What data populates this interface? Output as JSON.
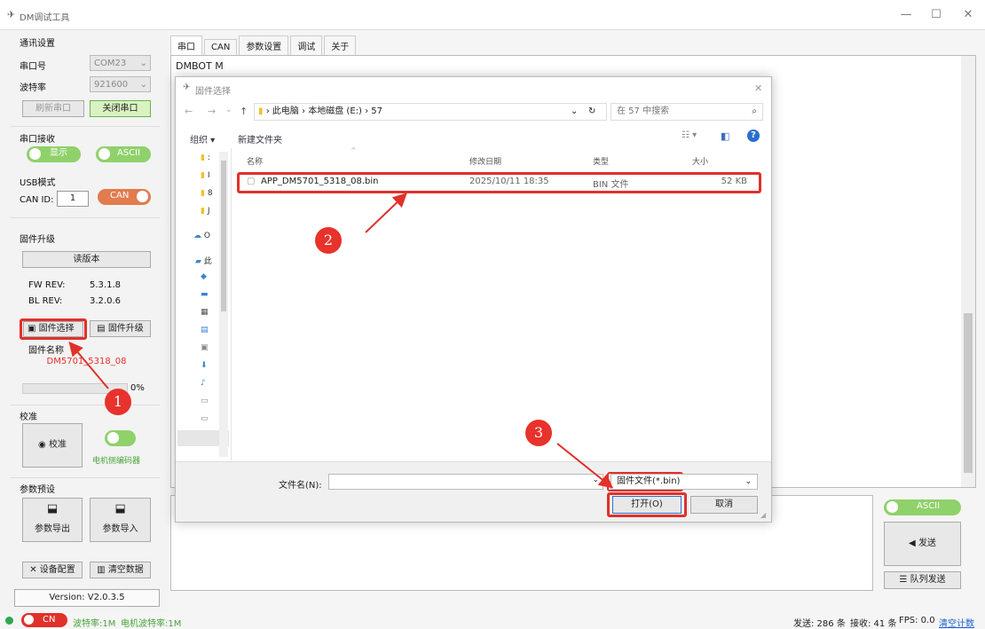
{
  "window": {
    "title": "DM调试工具",
    "minimize": "—",
    "maximize": "☐",
    "close": "✕"
  },
  "left": {
    "comm_settings": "通讯设置",
    "port_label": "串口号",
    "port_value": "COM23",
    "baud_label": "波特率",
    "baud_value": "921600",
    "refresh_btn": "刷新串口",
    "close_port_btn": "关闭串口",
    "rx_label": "串口接收",
    "display_toggle": "显示",
    "ascii_toggle": "ASCII",
    "usb_label": "USB模式",
    "canid_label": "CAN ID:",
    "canid_value": "1",
    "can_toggle": "CAN",
    "fw_upgrade": "固件升级",
    "read_version_btn": "读版本",
    "fw_rev_label": "FW REV:",
    "fw_rev": "5.3.1.8",
    "bl_rev_label": "BL REV:",
    "bl_rev": "3.2.0.6",
    "select_fw_btn": "固件选择",
    "upgrade_btn": "固件升级",
    "fw_name_label": "固件名称",
    "fw_name": "DM5701_5318_08",
    "progress_label": "0%",
    "progress": 0,
    "calib_label": "校准",
    "calib_radio": "校准",
    "encoder_label": "电机侧编码器",
    "params_label": "参数预设",
    "export_btn": "参数导出",
    "import_btn": "参数导入",
    "device_cfg_btn": "设备配置",
    "clear_data_btn": "清空数据",
    "version": "Version: V2.0.3.5"
  },
  "tabs": [
    "串口",
    "CAN",
    "参数设置",
    "调试",
    "关于"
  ],
  "main": {
    "log_line1": "DMBOT M"
  },
  "dialog": {
    "title": "固件选择",
    "path": [
      "此电脑",
      "本地磁盘 (E:)",
      "57"
    ],
    "search_placeholder": "在 57 中搜索",
    "organize": "组织 ▾",
    "new_folder": "新建文件夹",
    "columns": [
      "名称",
      "修改日期",
      "类型",
      "大小"
    ],
    "file": {
      "name": "APP_DM5701_5318_08.bin",
      "date": "2025/10/11 18:35",
      "type": "BIN 文件",
      "size": "52 KB"
    },
    "filename_label": "文件名(N):",
    "filter": "固件文件(*.bin)",
    "open_btn": "打开(O)",
    "cancel_btn": "取消"
  },
  "right": {
    "ascii_toggle": "ASCII",
    "send_btn": "发送",
    "queue_btn": "队列发送"
  },
  "annotations": [
    "1",
    "2",
    "3"
  ],
  "status": {
    "can_toggle": "CN",
    "baud": "波特率:1M",
    "motor_baud": "电机波特率:1M",
    "sent": "发送: 286 条",
    "recv": "接收: 41 条",
    "fps": "FPS: 0.0",
    "clear_count": "清空计数"
  },
  "colors": {
    "accent_green": "#8fd16b",
    "accent_red": "#e0312a",
    "can_orange": "#e27b4e"
  }
}
